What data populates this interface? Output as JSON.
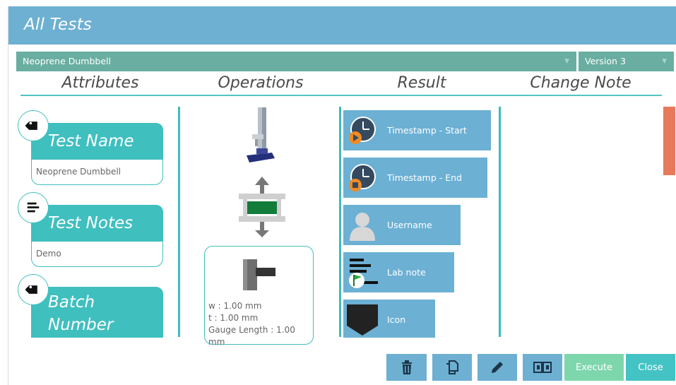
{
  "window": {
    "title": "All Tests"
  },
  "selectors": {
    "test": {
      "value": "Neoprene Dumbbell"
    },
    "version": {
      "value": "Version 3"
    }
  },
  "columns": {
    "attributes": "Attributes",
    "operations": "Operations",
    "result": "Result",
    "change_note": "Change Note"
  },
  "attributes": [
    {
      "label": "Test Name",
      "value": "Neoprene Dumbbell",
      "icon": "tag-icon"
    },
    {
      "label": "Test Notes",
      "value": "Demo",
      "icon": "text-lines-icon"
    },
    {
      "label": "Batch Number",
      "value": "",
      "icon": "tag-icon"
    }
  ],
  "operations": {
    "gauge": {
      "w": "w : 1.00 mm",
      "t": "t : 1.00 mm",
      "gauge_length": "Gauge Length : 1.00 mm"
    }
  },
  "results": [
    {
      "label": "Timestamp - Start",
      "icon": "clock-play-icon"
    },
    {
      "label": "Timestamp - End",
      "icon": "clock-stop-icon"
    },
    {
      "label": "Username",
      "icon": "user-icon"
    },
    {
      "label": "Lab note",
      "icon": "note-flag-icon"
    },
    {
      "label": "Icon",
      "icon": "icon-placeholder-icon"
    }
  ],
  "footer": {
    "execute": "Execute",
    "close": "Close"
  },
  "colors": {
    "title_bar": "#6db0d2",
    "select_bar": "#69aea1",
    "accent_teal": "#40bfbf",
    "result_tile": "#6cb0d4",
    "scroll_thumb": "#e8795b",
    "execute": "#7ed6ad"
  }
}
